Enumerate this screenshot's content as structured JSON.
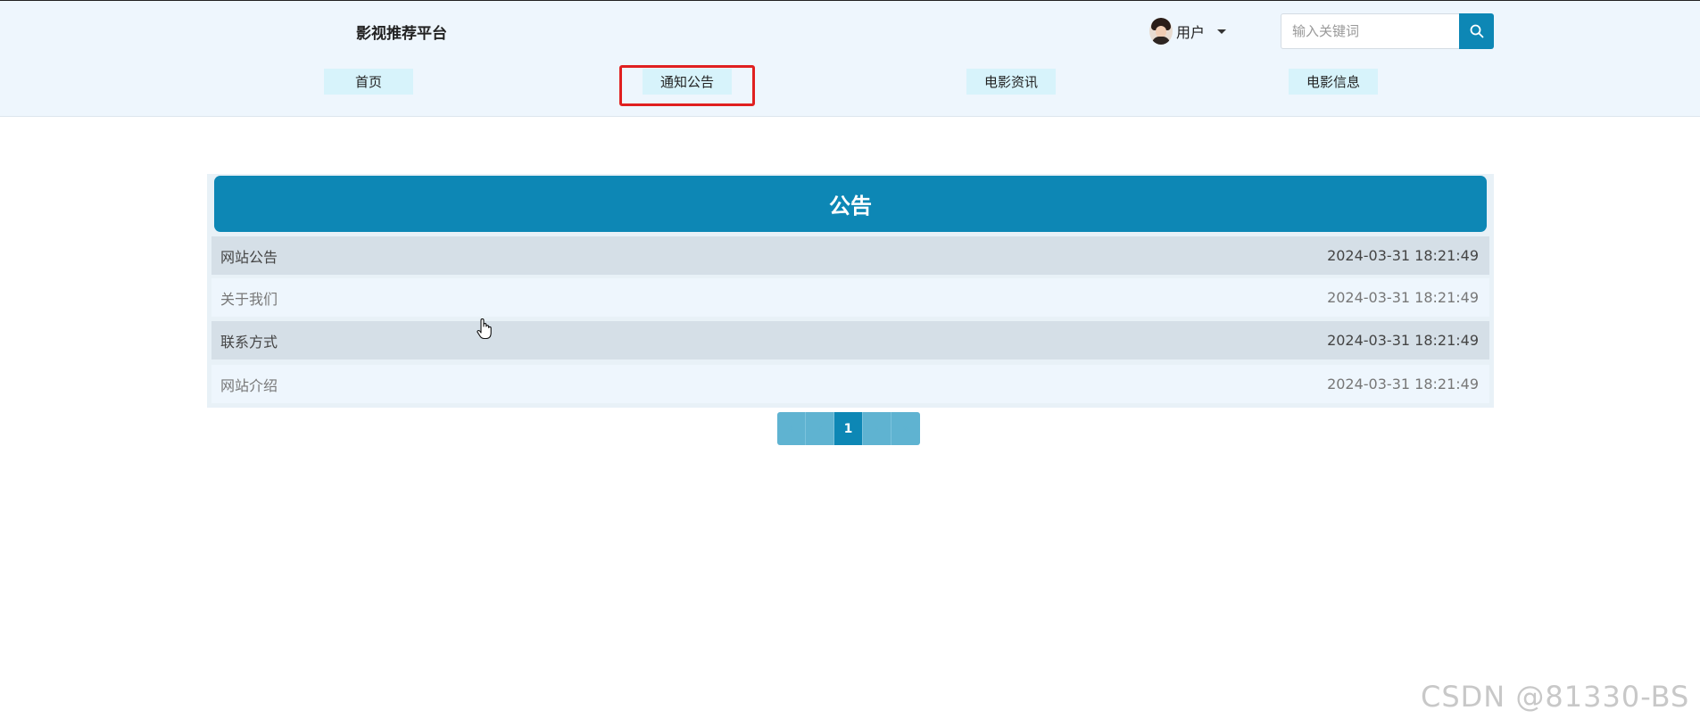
{
  "header": {
    "brand": "影视推荐平台",
    "user_label": "用户",
    "search_placeholder": "输入关键词"
  },
  "nav": {
    "home": "首页",
    "notice": "通知公告",
    "news": "电影资讯",
    "movie_info": "电影信息",
    "active": "通知公告"
  },
  "panel": {
    "title": "公告",
    "rows": [
      {
        "title": "网站公告",
        "time": "2024-03-31 18:21:49"
      },
      {
        "title": "关于我们",
        "time": "2024-03-31 18:21:49"
      },
      {
        "title": "联系方式",
        "time": "2024-03-31 18:21:49"
      },
      {
        "title": "网站介绍",
        "time": "2024-03-31 18:21:49"
      }
    ]
  },
  "pager": {
    "first": "«",
    "prev": "‹",
    "current": "1",
    "next": "›",
    "last": "»"
  },
  "watermark": "CSDN @81330-BS",
  "colors": {
    "accent": "#0d87b5",
    "header_bg": "#eef6fd",
    "nav_item_bg": "#d7f3fb",
    "highlight_box": "#e02020"
  },
  "icons": {
    "search": "search-icon",
    "caret": "caret-down-icon",
    "cursor": "hand-pointer-icon"
  }
}
